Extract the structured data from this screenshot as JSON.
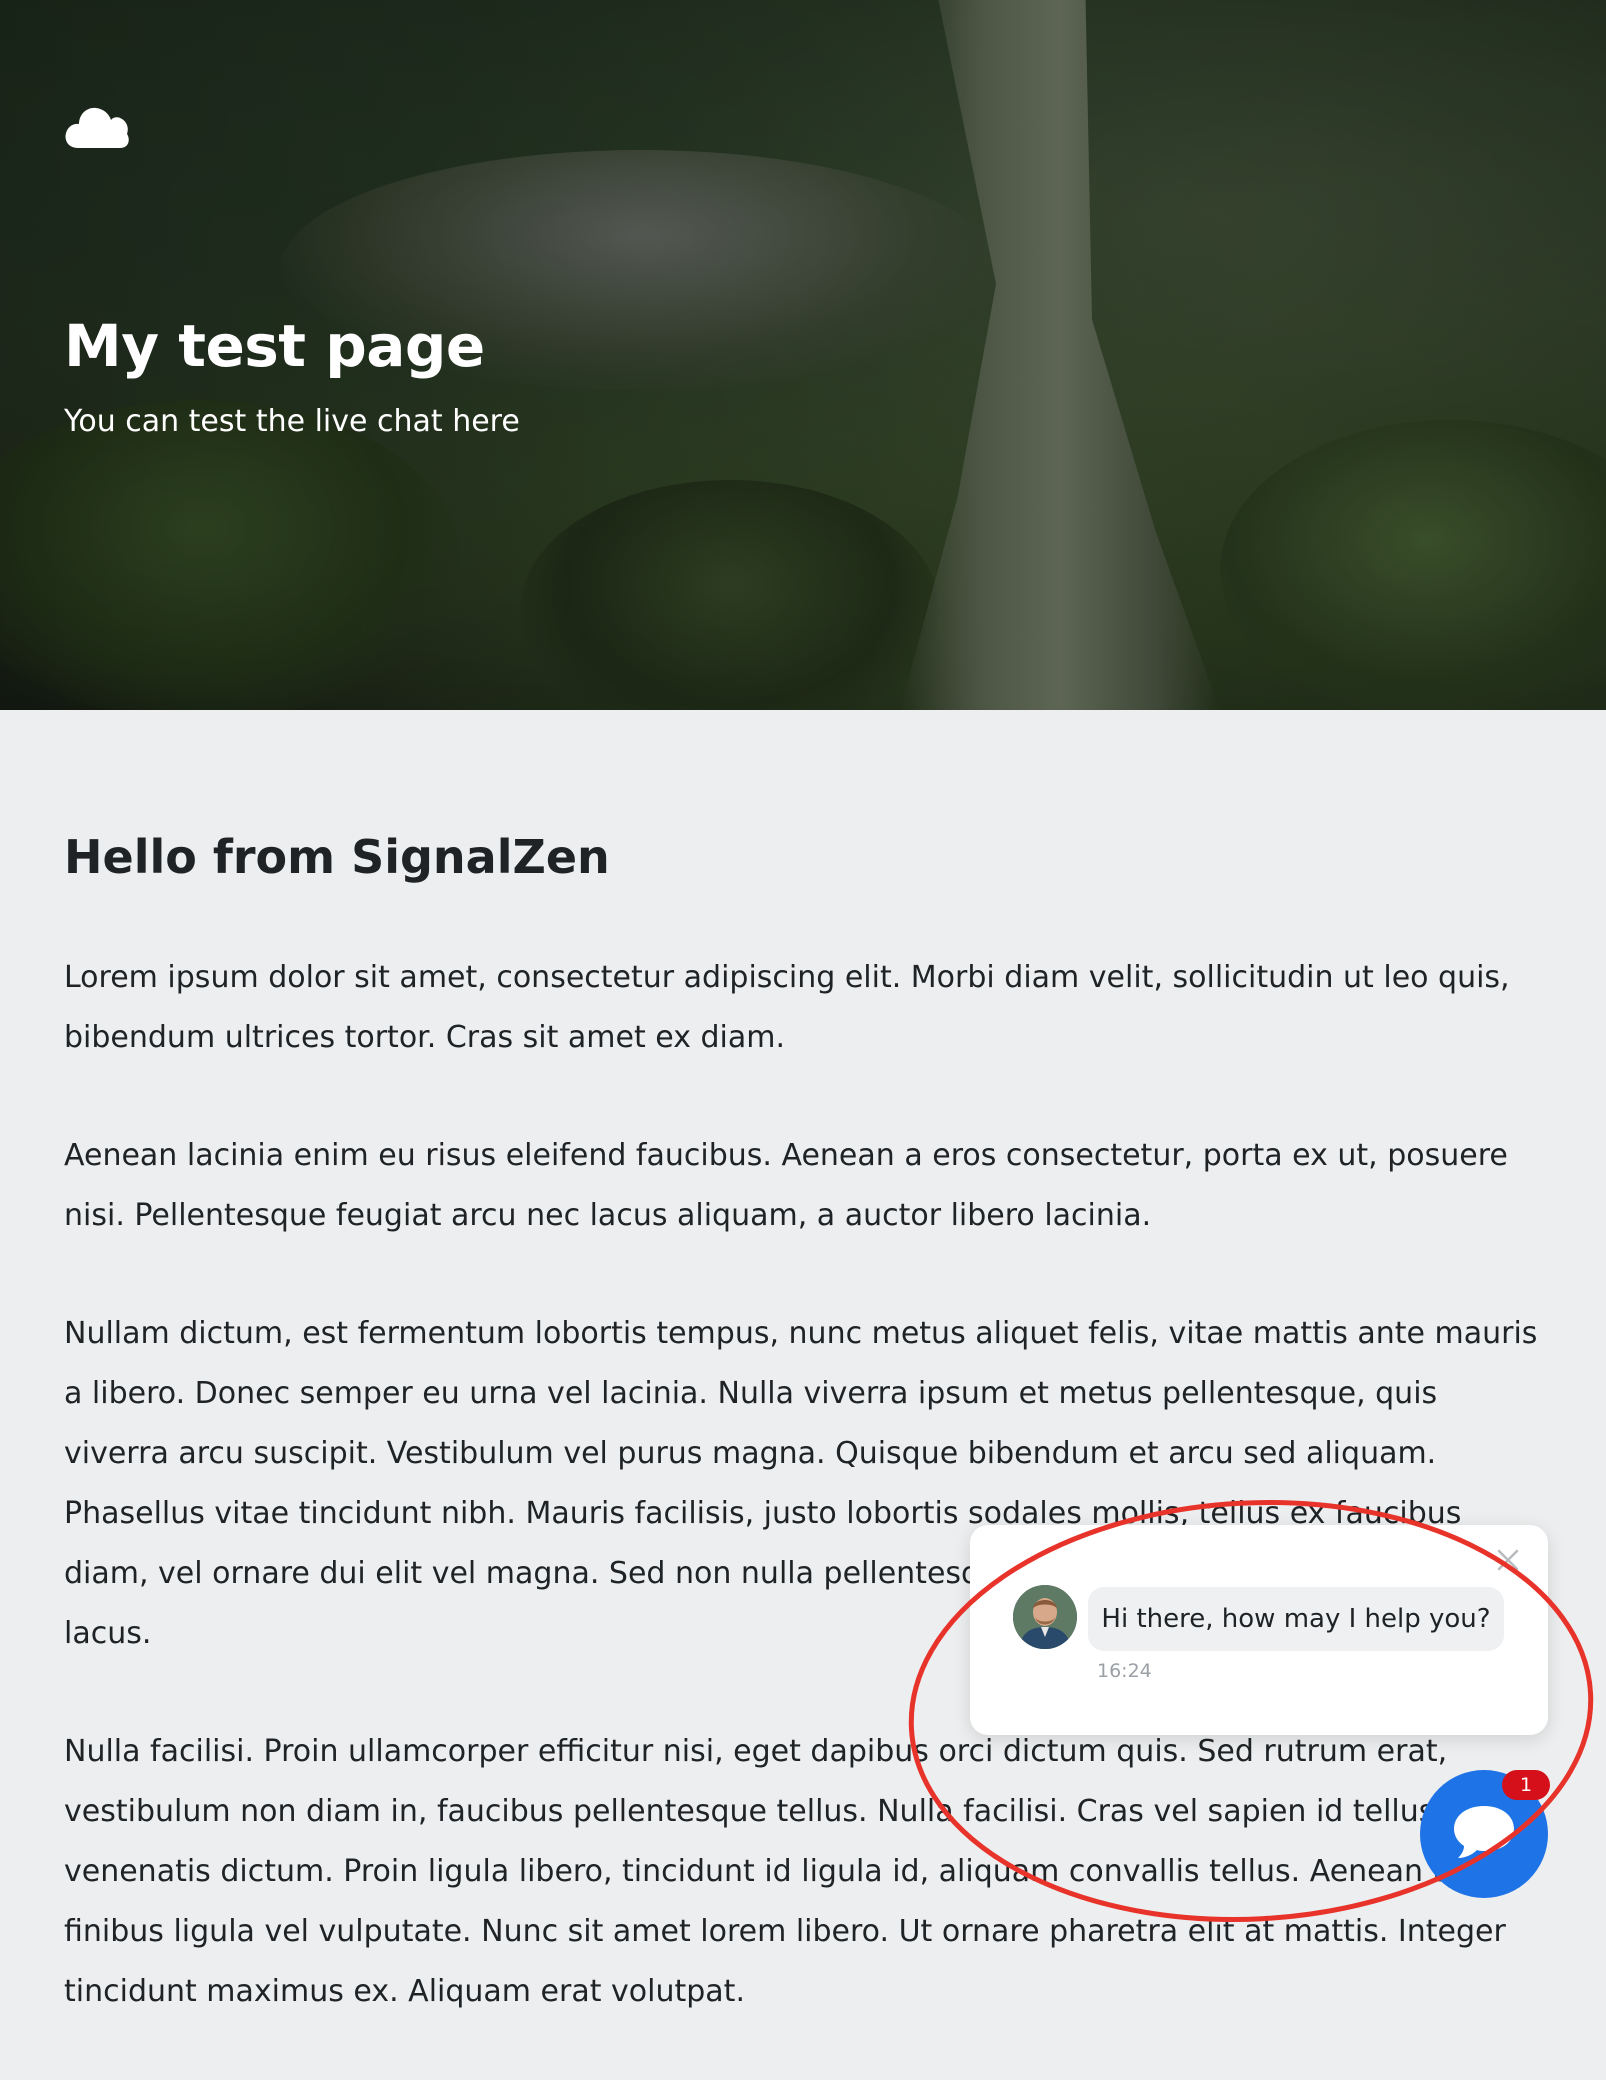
{
  "hero": {
    "title": "My test page",
    "subtitle": "You can test the live chat here",
    "logo_icon": "cloud-icon"
  },
  "main": {
    "heading": "Hello from SignalZen",
    "paragraphs": [
      "Lorem ipsum dolor sit amet, consectetur adipiscing elit. Morbi diam velit, sollicitudin ut leo quis, bibendum ultrices tortor. Cras sit amet ex diam.",
      "Aenean lacinia enim eu risus eleifend faucibus. Aenean a eros consectetur, porta ex ut, posuere nisi. Pellentesque feugiat arcu nec lacus aliquam, a auctor libero lacinia.",
      "Nullam dictum, est fermentum lobortis tempus, nunc metus aliquet felis, vitae mattis ante mauris a libero. Donec semper eu urna vel lacinia. Nulla viverra ipsum et metus pellentesque, quis viverra arcu suscipit. Vestibulum vel purus magna. Quisque bibendum et arcu sed aliquam. Phasellus vitae tincidunt nibh. Mauris facilisis, justo lobortis sodales mollis, tellus ex faucibus diam, vel ornare dui elit vel magna. Sed non nulla pellentesque, convallis mauris id, porttitor lacus.",
      "Nulla facilisi. Proin ullamcorper efficitur nisi, eget dapibus orci dictum quis. Sed rutrum erat, vestibulum non diam in, faucibus pellentesque tellus. Nulla facilisi. Cras vel sapien id tellus venenatis dictum. Proin ligula libero, tincidunt id ligula id, aliquam convallis tellus. Aenean ut finibus ligula vel vulputate. Nunc sit amet lorem libero. Ut ornare pharetra elit at mattis. Integer tincidunt maximus ex. Aliquam erat volutpat."
    ]
  },
  "chat": {
    "message": "Hi there, how may I help you?",
    "time": "16:24",
    "close_icon": "close-icon",
    "launcher_icon": "chat-bubble-icon",
    "unread_count": "1",
    "launcher_color": "#1e73e6",
    "badge_color": "#d6101a"
  },
  "annotation": {
    "color": "#e8332b"
  }
}
